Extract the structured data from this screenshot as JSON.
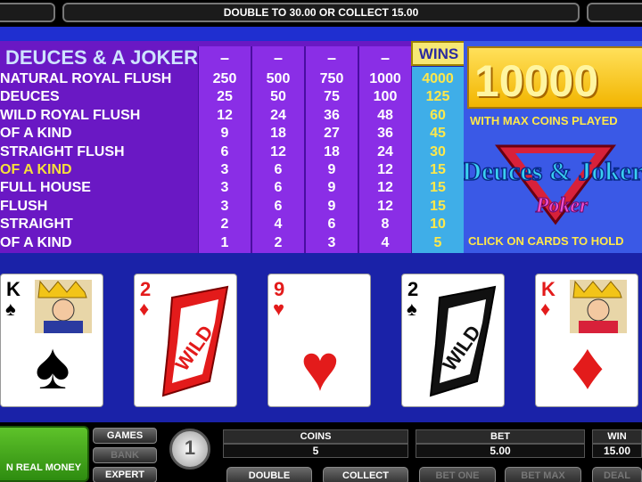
{
  "top_message": "DOUBLE TO 30.00 OR COLLECT 15.00",
  "paytable": {
    "title": "DEUCES & A JOKER",
    "column_dashes": [
      "–",
      "–",
      "–",
      "–"
    ],
    "wins_label": "WINS",
    "hands": [
      {
        "name": "NATURAL ROYAL FLUSH",
        "pays": [
          "250",
          "500",
          "750",
          "1000"
        ],
        "win": "4000",
        "highlight": false
      },
      {
        "name": "DEUCES",
        "pays": [
          "25",
          "50",
          "75",
          "100"
        ],
        "win": "125",
        "highlight": false
      },
      {
        "name": "WILD ROYAL FLUSH",
        "pays": [
          "12",
          "24",
          "36",
          "48"
        ],
        "win": "60",
        "highlight": false
      },
      {
        "name": "OF A KIND",
        "pays": [
          "9",
          "18",
          "27",
          "36"
        ],
        "win": "45",
        "highlight": false
      },
      {
        "name": "STRAIGHT FLUSH",
        "pays": [
          "6",
          "12",
          "18",
          "24"
        ],
        "win": "30",
        "highlight": false
      },
      {
        "name": "OF A KIND",
        "pays": [
          "3",
          "6",
          "9",
          "12"
        ],
        "win": "15",
        "highlight": true
      },
      {
        "name": "FULL HOUSE",
        "pays": [
          "3",
          "6",
          "9",
          "12"
        ],
        "win": "15",
        "highlight": false
      },
      {
        "name": "FLUSH",
        "pays": [
          "3",
          "6",
          "9",
          "12"
        ],
        "win": "15",
        "highlight": false
      },
      {
        "name": "STRAIGHT",
        "pays": [
          "2",
          "4",
          "6",
          "8"
        ],
        "win": "10",
        "highlight": false
      },
      {
        "name": "OF A KIND",
        "pays": [
          "1",
          "2",
          "3",
          "4"
        ],
        "win": "5",
        "highlight": false
      }
    ]
  },
  "promo": {
    "jackpot": "10000",
    "max_coins_text": "WITH MAX COINS PLAYED",
    "logo_line1": "Deuces & Joker",
    "logo_line2": "Poker",
    "click_text": "CLICK ON CARDS TO HOLD"
  },
  "cards": [
    {
      "rank": "K",
      "suit": "♠",
      "color": "#000000",
      "wild": false,
      "face": true
    },
    {
      "rank": "2",
      "suit": "♦",
      "color": "#e31b1b",
      "wild": true,
      "wild_label": "WILD",
      "face": false
    },
    {
      "rank": "9",
      "suit": "♥",
      "color": "#e31b1b",
      "wild": false,
      "face": false
    },
    {
      "rank": "2",
      "suit": "♠",
      "color": "#000000",
      "wild": true,
      "wild_label": "WILD",
      "face": false
    },
    {
      "rank": "K",
      "suit": "♦",
      "color": "#e31b1b",
      "wild": false,
      "face": true
    }
  ],
  "bottom": {
    "real_money": "N REAL MONEY",
    "games_label": "GAMES",
    "bank_label": "BANK",
    "expert_label": "EXPERT",
    "coin_value": "1",
    "coins_label": "COINS",
    "coins_value": "5",
    "bet_label": "BET",
    "bet_value": "5.00",
    "win_label": "WIN",
    "win_value": "15.00",
    "buttons": [
      "DOUBLE",
      "COLLECT",
      "BET ONE",
      "BET MAX",
      "DEAL"
    ]
  },
  "colors": {
    "paytable_bg": "#6a18c4",
    "column_bg": "#8a2ee6",
    "wins_bg": "#3faee8",
    "highlight": "#f6e03a",
    "felt": "#1a22a8"
  }
}
